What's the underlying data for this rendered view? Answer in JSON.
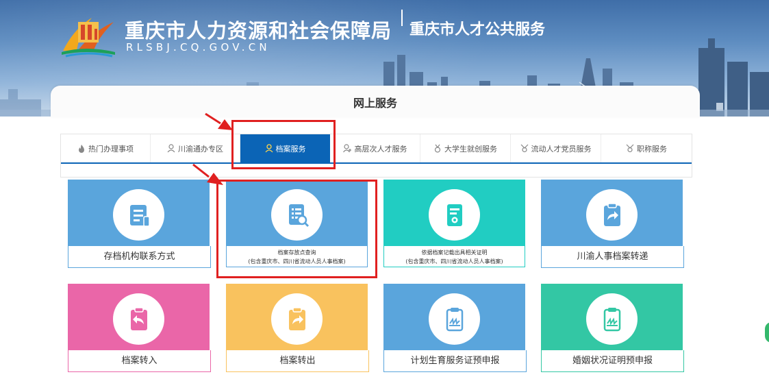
{
  "header": {
    "site_title": "重庆市人力资源和社会保障局",
    "site_domain": "RLSBJ.CQ.GOV.CN",
    "sub_title": "重庆市人才公共服务"
  },
  "panel": {
    "title": "网上服务"
  },
  "tabs": [
    {
      "label": "热门办理事项",
      "icon": "fire-icon",
      "active": false
    },
    {
      "label": "川渝通办专区",
      "icon": "user-icon",
      "active": false
    },
    {
      "label": "档案服务",
      "icon": "user-icon",
      "active": true
    },
    {
      "label": "高层次人才服务",
      "icon": "user-plus-icon",
      "active": false
    },
    {
      "label": "大学生就创服务",
      "icon": "medal-icon",
      "active": false
    },
    {
      "label": "流动人才党员服务",
      "icon": "badge-icon",
      "active": false
    },
    {
      "label": "职称服务",
      "icon": "badge-icon",
      "active": false
    }
  ],
  "cards": [
    {
      "title": "存档机构联系方式",
      "icon": "document-list-icon",
      "color": "#5aa5dc"
    },
    {
      "title": "档案存放点查询",
      "subtitle": "(包含重庆市、四川省流动人员人事档案)",
      "icon": "document-search-icon",
      "color": "#5aa5dc"
    },
    {
      "title": "依据档案记载出具相关证明",
      "subtitle": "(包含重庆市、四川省流动人员人事档案)",
      "icon": "certificate-icon",
      "color": "#21cdc2"
    },
    {
      "title": "川渝人事档案转递",
      "icon": "clipboard-forward-icon",
      "color": "#5aa5dc"
    },
    {
      "title": "档案转入",
      "icon": "clipboard-back-icon",
      "color": "#ea66a8"
    },
    {
      "title": "档案转出",
      "icon": "clipboard-forward-icon",
      "color": "#f9c25e"
    },
    {
      "title": "计划生育服务证预申报",
      "icon": "signed-clipboard-icon",
      "color": "#5aa5dc"
    },
    {
      "title": "婚姻状况证明预申报",
      "icon": "signed-clipboard-icon",
      "color": "#33c7a4"
    }
  ],
  "colors": {
    "accent": "#0b64b6",
    "highlight": "#e02020"
  }
}
